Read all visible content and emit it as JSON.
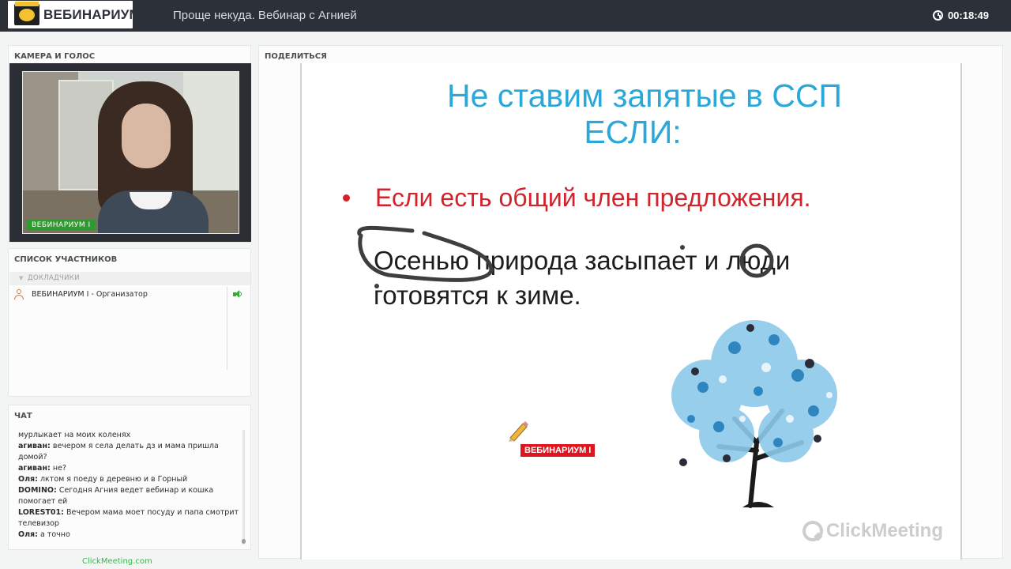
{
  "header": {
    "logo_text": "ВЕБИНАРИУМ",
    "title": "Проще некуда. Вебинар с Агнией",
    "timer": "00:18:49"
  },
  "camera": {
    "heading": "КАМЕРА И ГОЛОС",
    "label": "ВЕБИНАРИУМ I"
  },
  "participants": {
    "heading": "СПИСОК УЧАСТНИКОВ",
    "group": "ДОКЛАДЧИКИ",
    "user": "ВЕБИНАРИУМ I - Организатор"
  },
  "chat": {
    "heading": "ЧАТ",
    "messages": [
      {
        "author": "",
        "text": "мурлыкает на моих коленях"
      },
      {
        "author": "агиван:",
        "text": "вечером я села делать дз и мама пришла домой?"
      },
      {
        "author": "агиван:",
        "text": "не?"
      },
      {
        "author": "Оля:",
        "text": "лктом я поеду в деревню и в Горный"
      },
      {
        "author": "DOMINO:",
        "text": "Сегодня Агния ведет вебинар и кошка помогает ей"
      },
      {
        "author": "LOREST01:",
        "text": "Вечером мама моет посуду и папа смотрит телевизор"
      },
      {
        "author": "Оля:",
        "text": "а точно"
      }
    ]
  },
  "footer": {
    "link": "ClickMeeting.com"
  },
  "share": {
    "heading": "ПОДЕЛИТЬСЯ",
    "slide": {
      "title_line1": "Не ставим запятые в ССП",
      "title_line2": "ЕСЛИ:",
      "bullet": "Если есть общий член предложения.",
      "example_line1": "Осенью природа засыпает и люди",
      "example_line2": "готовятся к зиме."
    },
    "cursor_label": "ВЕБИНАРИУМ I",
    "watermark": "ClickMeeting"
  },
  "colors": {
    "topbar": "#2c3038",
    "accent_green": "#2f9a2f",
    "slide_title": "#2aa8d8",
    "slide_bullet": "#d2232a",
    "cursor_tag": "#e0141c"
  }
}
